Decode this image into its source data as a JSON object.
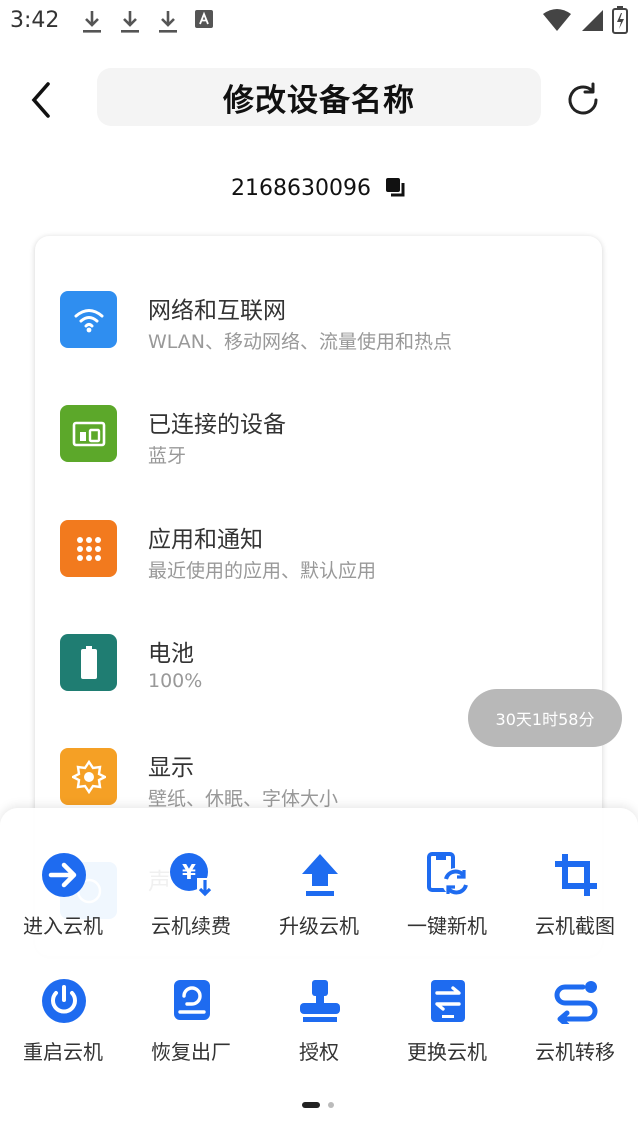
{
  "status_bar": {
    "time": "3:42",
    "left_icons": [
      "download-icon",
      "download-icon",
      "download-icon",
      "font-icon"
    ],
    "right_icons": [
      "wifi-icon",
      "signal-icon",
      "battery-icon"
    ]
  },
  "header": {
    "title": "修改设备名称",
    "back_icon": "chevron-left-icon",
    "refresh_icon": "refresh-icon"
  },
  "device": {
    "id": "2168630096",
    "copy_icon": "copy-icon"
  },
  "settings_screen": {
    "items": [
      {
        "title": "网络和互联网",
        "subtitle": "WLAN、移动网络、流量使用和热点",
        "icon": "wifi-icon",
        "color": "#2f8ef0"
      },
      {
        "title": "已连接的设备",
        "subtitle": "蓝牙",
        "icon": "devices-icon",
        "color": "#5ca82a"
      },
      {
        "title": "应用和通知",
        "subtitle": "最近使用的应用、默认应用",
        "icon": "apps-icon",
        "color": "#f27a1e"
      },
      {
        "title": "电池",
        "subtitle": "100%",
        "icon": "battery-icon",
        "color": "#1f7d72"
      },
      {
        "title": "显示",
        "subtitle": "壁纸、休眠、字体大小",
        "icon": "brightness-icon",
        "color": "#f5a025"
      },
      {
        "title": "声",
        "subtitle": "",
        "icon": "sound-icon",
        "color": "#2f8ef0"
      }
    ]
  },
  "timer": {
    "text": "30天1时58分"
  },
  "actions_row1": [
    {
      "label": "进入云机",
      "icon": "enter-icon"
    },
    {
      "label": "云机续费",
      "icon": "renew-icon"
    },
    {
      "label": "升级云机",
      "icon": "upgrade-icon"
    },
    {
      "label": "一键新机",
      "icon": "new-device-icon"
    },
    {
      "label": "云机截图",
      "icon": "crop-icon"
    }
  ],
  "actions_row2": [
    {
      "label": "重启云机",
      "icon": "power-icon"
    },
    {
      "label": "恢复出厂",
      "icon": "factory-reset-icon"
    },
    {
      "label": "授权",
      "icon": "stamp-icon"
    },
    {
      "label": "更换云机",
      "icon": "replace-icon"
    },
    {
      "label": "云机转移",
      "icon": "transfer-icon"
    }
  ],
  "pager": {
    "pages": 2,
    "current": 1
  },
  "colors": {
    "accent": "#1e6bf0",
    "timer_bg": "#b8b8b8"
  }
}
